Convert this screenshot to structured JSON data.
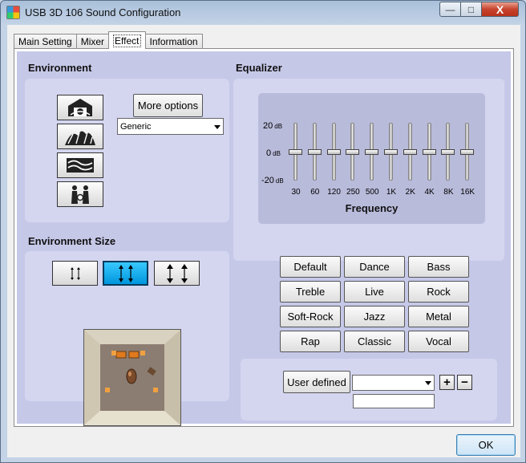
{
  "window": {
    "title": "USB 3D 106 Sound Configuration"
  },
  "titlebar_buttons": {
    "minimize": "—",
    "maximize": "□",
    "close": "X"
  },
  "tabs": [
    {
      "label": "Main Setting"
    },
    {
      "label": "Mixer"
    },
    {
      "label": "Effect",
      "active": true
    },
    {
      "label": "Information"
    }
  ],
  "environment": {
    "title": "Environment",
    "more_options_label": "More options",
    "selected_environment": "Generic",
    "preset_icons": [
      "living-room-icon",
      "concert-hall-icon",
      "underwater-icon",
      "headphone-listener-icon"
    ]
  },
  "environment_size": {
    "title": "Environment Size",
    "options": [
      "small-size-icon",
      "medium-size-icon",
      "large-size-icon"
    ],
    "selected_index": 1
  },
  "equalizer": {
    "title": "Equalizer",
    "db_labels": [
      {
        "value": "20",
        "unit": "dB"
      },
      {
        "value": "0",
        "unit": "dB"
      },
      {
        "value": "-20",
        "unit": "dB"
      }
    ],
    "bands": [
      {
        "freq": "30",
        "gain": 0
      },
      {
        "freq": "60",
        "gain": 0
      },
      {
        "freq": "120",
        "gain": 0
      },
      {
        "freq": "250",
        "gain": 0
      },
      {
        "freq": "500",
        "gain": 0
      },
      {
        "freq": "1K",
        "gain": 0
      },
      {
        "freq": "2K",
        "gain": 0
      },
      {
        "freq": "4K",
        "gain": 0
      },
      {
        "freq": "8K",
        "gain": 0
      },
      {
        "freq": "16K",
        "gain": 0
      }
    ],
    "axis_label": "Frequency",
    "presets": [
      "Default",
      "Dance",
      "Bass",
      "Treble",
      "Live",
      "Rock",
      "Soft-Rock",
      "Jazz",
      "Metal",
      "Rap",
      "Classic",
      "Vocal"
    ],
    "user_defined_label": "User defined",
    "user_defined_selected": "",
    "user_defined_name": "",
    "add_label": "+",
    "remove_label": "−"
  },
  "footer": {
    "ok_label": "OK"
  },
  "colors": {
    "panel_bg": "#c6c8e8",
    "group_bg": "#d4d6f0",
    "selected_size": "#0fb3f0"
  }
}
